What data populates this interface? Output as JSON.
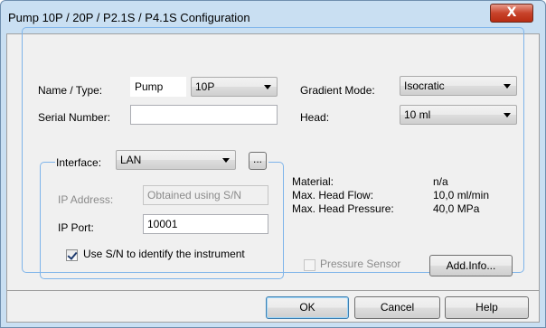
{
  "window": {
    "title": "Pump 10P / 20P / P2.1S / P4.1S Configuration",
    "close_glyph": "X"
  },
  "name_type": {
    "label": "Name / Type:",
    "name_value": "Pump",
    "type_value": "10P"
  },
  "serial": {
    "label": "Serial Number:",
    "value": ""
  },
  "gradient": {
    "label": "Gradient Mode:",
    "value": "Isocratic"
  },
  "head": {
    "label": "Head:",
    "value": "10 ml"
  },
  "interface": {
    "label": "Interface:",
    "value": "LAN",
    "browse_label": "...",
    "ip_address_label": "IP Address:",
    "ip_address_value": "Obtained using S/N",
    "ip_port_label": "IP Port:",
    "ip_port_value": "10001",
    "use_sn_label": "Use S/N to identify the instrument",
    "use_sn_checked": true
  },
  "info": {
    "material_label": "Material:",
    "material_value": "n/a",
    "flow_label": "Max. Head Flow:",
    "flow_value": "10,0 ml/min",
    "pressure_label": "Max. Head Pressure:",
    "pressure_value": "40,0 MPa"
  },
  "pressure_sensor": {
    "label": "Pressure Sensor",
    "checked": false,
    "enabled": false
  },
  "buttons": {
    "add_info": "Add.Info...",
    "ok": "OK",
    "cancel": "Cancel",
    "help": "Help"
  }
}
